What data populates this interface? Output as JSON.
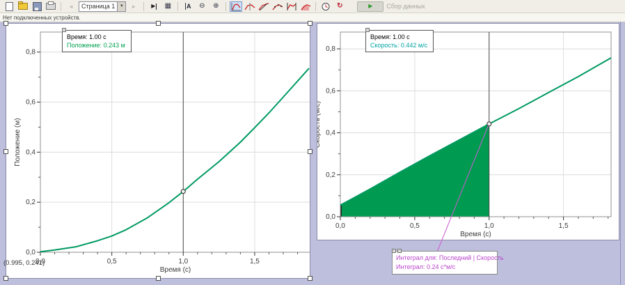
{
  "toolbar": {
    "page_selector": {
      "label": "Страница 1"
    },
    "collect": {
      "label": "Сбор данных"
    },
    "glyphs": {
      "back": "◄",
      "forward": "►",
      "dropdown_arrow": "▼",
      "next_page": "▶",
      "data_table": "▦",
      "examine_letter": "A",
      "zoom_out": "⊖",
      "zoom_in": "⊕",
      "replay": "↻",
      "play": "▶"
    },
    "icons": [
      "new-document",
      "open",
      "save",
      "print",
      "back",
      "page-selector",
      "forward",
      "next-page",
      "data-table",
      "examine",
      "zoom-out",
      "zoom-in",
      "autoscale",
      "interpolate",
      "tangent",
      "curve-fit",
      "statistics",
      "integral",
      "clock",
      "replay",
      "collect"
    ]
  },
  "status_bar": {
    "text": "Нет подключенных устройств."
  },
  "left_panel": {
    "tooltip": {
      "line1": "Время: 1.00 с",
      "line2": "Положение: 0.243 м",
      "line2_color": "#00A050"
    },
    "coords_label": "(0.995, 0.241)"
  },
  "right_panel": {
    "tooltip": {
      "line1": "Время: 1.00 с",
      "line2": "Скорость: 0.442 м/с",
      "line2_color": "#00A3A3"
    }
  },
  "annotation": {
    "line1": "Интеграл для: Последний | Скорость",
    "line2": "Интеграл: 0.24 с*м/с",
    "text_color": "#BB44CC"
  },
  "colors": {
    "curve_green": "#009A62",
    "integral_fill": "#009B50",
    "callout_line": "#CF5AD2",
    "workspace": "#BDBFDD",
    "cursor_line": "#4A4A4A"
  },
  "chart_data": [
    {
      "id": "position",
      "type": "line",
      "title": "",
      "xlabel": "Время (с)",
      "ylabel": "Положение (м)",
      "xlim": [
        0,
        1.89
      ],
      "ylim": [
        0,
        0.88
      ],
      "xticks": {
        "values": [
          0,
          0.5,
          1.0,
          1.5
        ],
        "labels": [
          "0,0",
          "0,5",
          "1,0",
          "1,5"
        ]
      },
      "yticks": {
        "values": [
          0,
          0.2,
          0.4,
          0.6,
          0.8
        ],
        "labels": [
          "0,0",
          "0,2",
          "0,4",
          "0,6",
          "0,8"
        ]
      },
      "minor_step_x": 0.1,
      "minor_step_y": 0.1,
      "grid": true,
      "line_color": "#009A62",
      "cursor_x": 1.0,
      "marker": {
        "x": 1.0,
        "y": 0.243
      },
      "series": [
        {
          "name": "Положение",
          "points": [
            [
              0,
              0.002
            ],
            [
              0.1,
              0.009
            ],
            [
              0.25,
              0.022
            ],
            [
              0.4,
              0.046
            ],
            [
              0.5,
              0.065
            ],
            [
              0.6,
              0.09
            ],
            [
              0.75,
              0.138
            ],
            [
              0.9,
              0.198
            ],
            [
              1.0,
              0.243
            ],
            [
              1.1,
              0.292
            ],
            [
              1.25,
              0.362
            ],
            [
              1.4,
              0.44
            ],
            [
              1.5,
              0.498
            ],
            [
              1.6,
              0.557
            ],
            [
              1.75,
              0.652
            ],
            [
              1.88,
              0.735
            ]
          ]
        }
      ]
    },
    {
      "id": "velocity",
      "type": "line",
      "title": "",
      "xlabel": "Время (с)",
      "ylabel": "Скорость (м/с)",
      "xlim": [
        0,
        1.82
      ],
      "ylim": [
        0,
        0.88
      ],
      "xticks": {
        "values": [
          0,
          0.5,
          1.0,
          1.5
        ],
        "labels": [
          "0,0",
          "0,5",
          "1,0",
          "1,5"
        ]
      },
      "yticks": {
        "values": [
          0,
          0.2,
          0.4,
          0.6,
          0.8
        ],
        "labels": [
          "0,0",
          "0,2",
          "0,4",
          "0,6",
          "0,8"
        ]
      },
      "minor_step_x": 0.1,
      "minor_step_y": 0.1,
      "grid": true,
      "line_color": "#009A62",
      "fill": {
        "x0": 0,
        "x1": 1.0,
        "color": "#009B50",
        "integral_value": 0.24
      },
      "cursor_x": 1.0,
      "marker": {
        "x": 1.0,
        "y": 0.442
      },
      "series": [
        {
          "name": "Скорость",
          "points": [
            [
              0,
              0.055
            ],
            [
              0.2,
              0.132
            ],
            [
              0.4,
              0.212
            ],
            [
              0.6,
              0.29
            ],
            [
              0.8,
              0.366
            ],
            [
              1.0,
              0.442
            ],
            [
              1.2,
              0.515
            ],
            [
              1.4,
              0.592
            ],
            [
              1.6,
              0.668
            ],
            [
              1.82,
              0.757
            ]
          ]
        }
      ]
    }
  ]
}
